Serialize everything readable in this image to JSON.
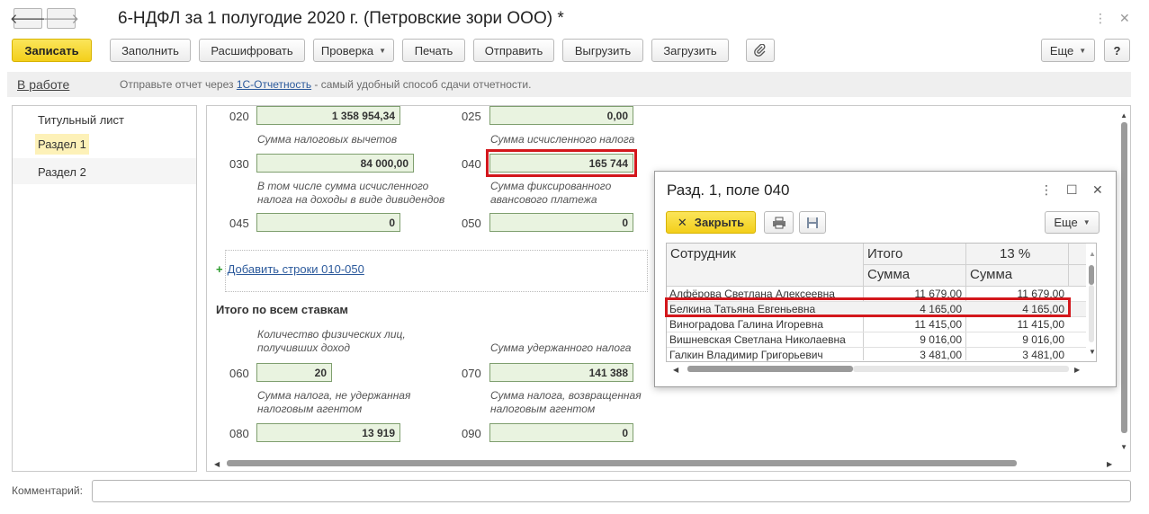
{
  "window": {
    "title": "6-НДФЛ за 1 полугодие 2020 г. (Петровские зори ООО) *",
    "back_icon": "arrow-left-icon",
    "forward_icon": "arrow-right-icon",
    "menu_icon": "more-vert-icon",
    "close_icon": "close-icon"
  },
  "toolbar": {
    "save": "Записать",
    "fill": "Заполнить",
    "decode": "Расшифровать",
    "check": "Проверка",
    "print": "Печать",
    "send": "Отправить",
    "export": "Выгрузить",
    "import": "Загрузить",
    "attach_icon": "paperclip-icon",
    "more": "Еще",
    "help": "?"
  },
  "infobar": {
    "status": "В работе",
    "text_before": "Отправьте отчет через ",
    "link": "1С-Отчетность",
    "text_after": " - самый удобный способ сдачи отчетности."
  },
  "sidebar": {
    "items": [
      "Титульный лист",
      "Раздел 1",
      "Раздел 2"
    ],
    "selected": "Раздел 1"
  },
  "form": {
    "c020": "020",
    "v020": "1 358 954,34",
    "c025": "025",
    "v025": "0,00",
    "l030": "Сумма налоговых вычетов",
    "l040": "Сумма исчисленного налога",
    "c030": "030",
    "v030": "84 000,00",
    "c040": "040",
    "v040": "165 744",
    "l045": "В том числе сумма исчисленного налога на доходы в виде дивидендов",
    "l050": "Сумма фиксированного авансового платежа",
    "c045": "045",
    "v045": "0",
    "c050": "050",
    "v050": "0",
    "add_rows": "Добавить строки 010-050",
    "total_section": "Итого по всем ставкам",
    "l060": "Количество физических лиц, получивших доход",
    "l070": "Сумма удержанного налога",
    "c060": "060",
    "v060": "20",
    "c070": "070",
    "v070": "141 388",
    "l080": "Сумма налога, не удержанная налоговым агентом",
    "l090": "Сумма налога, возвращенная налоговым агентом",
    "c080": "080",
    "v080": "13 919",
    "c090": "090",
    "v090": "0"
  },
  "popup": {
    "title": "Разд. 1, поле 040",
    "close_btn": "Закрыть",
    "more": "Еще",
    "columns": {
      "employee": "Сотрудник",
      "total": "Итого",
      "rate": "13 %",
      "sum1": "Сумма",
      "sum2": "Сумма"
    },
    "rows": [
      {
        "name": "Алфёрова Светлана Алексеевна",
        "total": "11 679,00",
        "rate13": "11 679,00"
      },
      {
        "name": "Белкина Татьяна Евгеньевна",
        "total": "4 165,00",
        "rate13": "4 165,00"
      },
      {
        "name": "Виноградова Галина Игоревна",
        "total": "11 415,00",
        "rate13": "11 415,00"
      },
      {
        "name": "Вишневская Светлана Николаевна",
        "total": "9 016,00",
        "rate13": "9 016,00"
      },
      {
        "name": "Галкин Владимир Григорьевич",
        "total": "3 481,00",
        "rate13": "3 481,00"
      }
    ],
    "highlighted_row": "Белкина Татьяна Евгеньевна"
  },
  "comment": {
    "label": "Комментарий:",
    "value": ""
  },
  "colors": {
    "primary_button": "#f5d324",
    "field_bg": "#e9f3e0",
    "highlight_border": "#d3171c",
    "selected_item": "#fdf1b8"
  }
}
